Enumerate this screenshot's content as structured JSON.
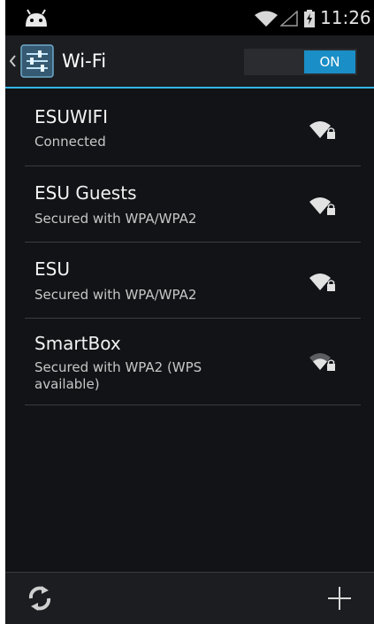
{
  "status_bar": {
    "time": "11:26",
    "icons": [
      "android-icon",
      "wifi-signal-icon",
      "cell-signal-icon",
      "battery-charging-icon"
    ]
  },
  "action_bar": {
    "title": "Wi-Fi",
    "toggle_label": "ON",
    "accent_color": "#33b5e5"
  },
  "networks": [
    {
      "ssid": "ESUWIFI",
      "status": "Connected",
      "icon": "wifi-secured-icon"
    },
    {
      "ssid": "ESU Guests",
      "status": "Secured with WPA/WPA2",
      "icon": "wifi-secured-icon"
    },
    {
      "ssid": "ESU",
      "status": "Secured with WPA/WPA2",
      "icon": "wifi-secured-icon"
    },
    {
      "ssid": "SmartBox",
      "status": "Secured with WPA2 (WPS available)",
      "icon": "wifi-secured-weak-icon"
    }
  ],
  "bottom_bar": {
    "icons": [
      "refresh-icon",
      "add-network-icon"
    ]
  }
}
